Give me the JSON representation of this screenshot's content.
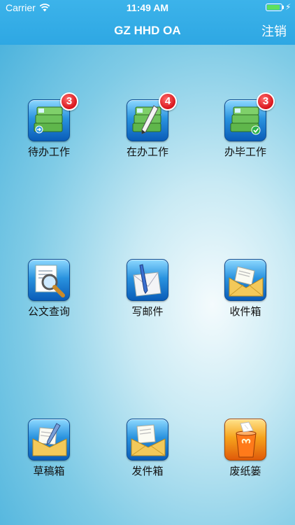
{
  "status_bar": {
    "carrier": "Carrier",
    "time": "11:49 AM",
    "battery_level": 0.92
  },
  "nav": {
    "title": "GZ HHD OA",
    "logout_label": "注销"
  },
  "grid": {
    "items": [
      {
        "label": "待办工作",
        "badge": "3",
        "icon": "inbox-tasks-icon"
      },
      {
        "label": "在办工作",
        "badge": "4",
        "icon": "tasks-in-progress-icon"
      },
      {
        "label": "办毕工作",
        "badge": "3",
        "icon": "tasks-done-icon"
      },
      {
        "label": "公文查询",
        "icon": "document-search-icon"
      },
      {
        "label": "写邮件",
        "icon": "compose-mail-icon"
      },
      {
        "label": "收件箱",
        "icon": "inbox-mail-icon"
      },
      {
        "label": "草稿箱",
        "icon": "drafts-icon"
      },
      {
        "label": "发件箱",
        "icon": "sent-mail-icon"
      },
      {
        "label": "废纸篓",
        "icon": "trash-icon"
      }
    ]
  },
  "colors": {
    "nav_bar": "#2ea7e3",
    "badge": "#d8141b",
    "tile_blue": "#2a93df",
    "trash_orange": "#f6a31c"
  }
}
